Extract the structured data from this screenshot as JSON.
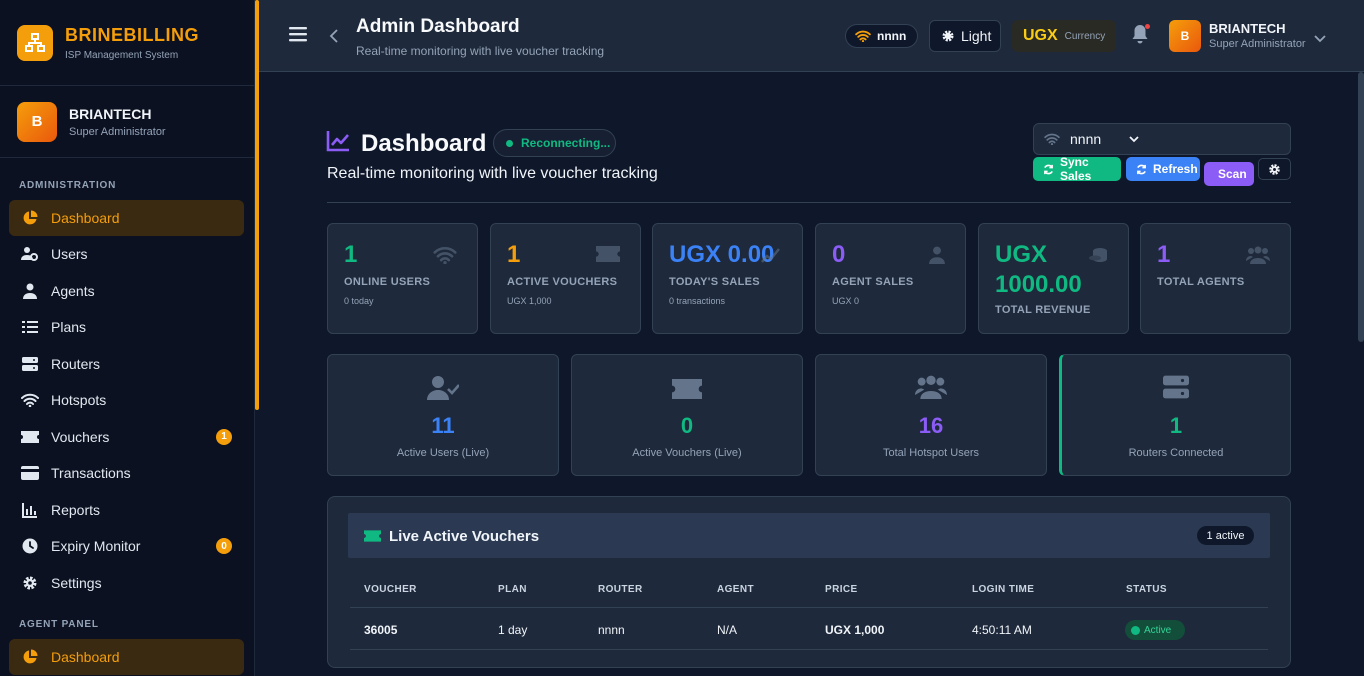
{
  "brand": {
    "name": "BRINEBILLING",
    "subtitle": "ISP Management System"
  },
  "sidebar_user": {
    "initial": "B",
    "name": "BRIANTECH",
    "role": "Super Administrator"
  },
  "sidebar": {
    "section_admin": "ADMINISTRATION",
    "section_agent": "AGENT PANEL",
    "items": [
      {
        "label": "Dashboard"
      },
      {
        "label": "Users"
      },
      {
        "label": "Agents"
      },
      {
        "label": "Plans"
      },
      {
        "label": "Routers"
      },
      {
        "label": "Hotspots"
      },
      {
        "label": "Vouchers",
        "badge": "1"
      },
      {
        "label": "Transactions"
      },
      {
        "label": "Reports"
      },
      {
        "label": "Expiry Monitor",
        "badge": "0"
      },
      {
        "label": "Settings"
      }
    ],
    "agent_items": [
      {
        "label": "Dashboard"
      }
    ]
  },
  "topbar": {
    "title": "Admin Dashboard",
    "subtitle": "Real-time monitoring with live voucher tracking",
    "router": "nnnn",
    "theme_label": "Light",
    "currency_code": "UGX",
    "currency_label": "Currency",
    "user_initial": "B",
    "user_name": "BRIANTECH",
    "user_role": "Super Administrator"
  },
  "main": {
    "title": "Dashboard",
    "status": "Reconnecting...",
    "subtitle": "Real-time monitoring with live voucher tracking",
    "router_select": "nnnn",
    "buttons": {
      "sync": "Sync Sales",
      "refresh": "Refresh",
      "scan": "Scan"
    }
  },
  "stats": [
    {
      "value": "1",
      "label": "ONLINE USERS",
      "sub": "0 today",
      "color": "#10b981",
      "icon": "wifi-icon"
    },
    {
      "value": "1",
      "label": "ACTIVE VOUCHERS",
      "sub": "UGX 1,000",
      "color": "#f59e0b",
      "icon": "ticket-icon"
    },
    {
      "value": "UGX 0.00",
      "label": "TODAY'S SALES",
      "sub": "0 transactions",
      "color": "#3b82f6",
      "icon": "chart-icon"
    },
    {
      "value": "0",
      "label": "AGENT SALES",
      "sub": "UGX 0",
      "color": "#8b5cf6",
      "icon": "user-icon"
    },
    {
      "value": "UGX 1000.00",
      "label": "TOTAL REVENUE",
      "sub": "",
      "color": "#10b981",
      "icon": "coins-icon"
    },
    {
      "value": "1",
      "label": "TOTAL AGENTS",
      "sub": "",
      "color": "#8b5cf6",
      "icon": "users-icon"
    }
  ],
  "live": [
    {
      "value": "11",
      "label": "Active Users (Live)",
      "color": "#3b82f6",
      "icon": "user-check-icon"
    },
    {
      "value": "0",
      "label": "Active Vouchers (Live)",
      "color": "#10b981",
      "icon": "ticket-icon"
    },
    {
      "value": "16",
      "label": "Total Hotspot Users",
      "color": "#8b5cf6",
      "icon": "users-icon"
    },
    {
      "value": "1",
      "label": "Routers Connected",
      "color": "#10b981",
      "icon": "server-icon"
    }
  ],
  "vouchers_table": {
    "title": "Live Active Vouchers",
    "badge": "1 active",
    "columns": [
      "VOUCHER",
      "PLAN",
      "ROUTER",
      "AGENT",
      "PRICE",
      "LOGIN TIME",
      "STATUS"
    ],
    "rows": [
      {
        "voucher": "36005",
        "plan": "1 day",
        "router": "nnnn",
        "agent": "N/A",
        "price": "UGX 1,000",
        "login_time": "4:50:11 AM",
        "status": "Active"
      }
    ]
  }
}
